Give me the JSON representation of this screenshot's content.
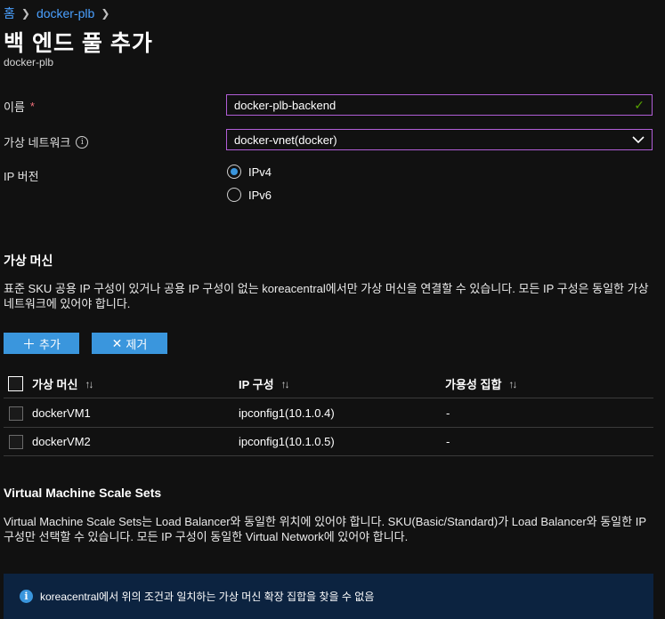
{
  "breadcrumb": {
    "home": "홈",
    "parent": "docker-plb"
  },
  "page": {
    "title": "백 엔드 풀 추가",
    "subtitle": "docker-plb"
  },
  "form": {
    "name_label": "이름",
    "required_mark": "*",
    "name_value": "docker-plb-backend",
    "vnet_label": "가상 네트워크",
    "vnet_value": "docker-vnet(docker)",
    "ip_version_label": "IP 버전",
    "ip_options": [
      "IPv4",
      "IPv6"
    ],
    "ip_selected": "IPv4"
  },
  "vm_section": {
    "title": "가상 머신",
    "description": "표준 SKU 공용 IP 구성이 있거나 공용 IP 구성이 없는 koreacentral에서만 가상 머신을 연결할 수 있습니다. 모든 IP 구성은 동일한 가상 네트워크에 있어야 합니다.",
    "add_label": "추가",
    "remove_label": "제거",
    "columns": [
      "가상 머신",
      "IP 구성",
      "가용성 집합"
    ],
    "rows": [
      {
        "vm": "dockerVM1",
        "ip": "ipconfig1(10.1.0.4)",
        "availability": "-"
      },
      {
        "vm": "dockerVM2",
        "ip": "ipconfig1(10.1.0.5)",
        "availability": "-"
      }
    ]
  },
  "vmss_section": {
    "title": "Virtual Machine Scale Sets",
    "description": "Virtual Machine Scale Sets는 Load Balancer와 동일한 위치에 있어야 합니다. SKU(Basic/Standard)가 Load Balancer와 동일한 IP 구성만 선택할 수 있습니다. 모든 IP 구성이 동일한 Virtual Network에 있어야 합니다.",
    "info_message": "koreacentral에서 위의 조건과 일치하는 가상 머신 확장 집합을 찾을 수 없음"
  },
  "colors": {
    "accent": "#3a96dd",
    "link": "#4aa0ff",
    "focus_border": "#b15ed7",
    "valid": "#57a300",
    "info_bg": "#0c2340"
  },
  "icons": [
    "chevron-right-icon",
    "info-icon",
    "checkmark-icon",
    "chevron-down-icon",
    "plus-icon",
    "x-icon",
    "sort-icon",
    "info-circle-icon"
  ]
}
